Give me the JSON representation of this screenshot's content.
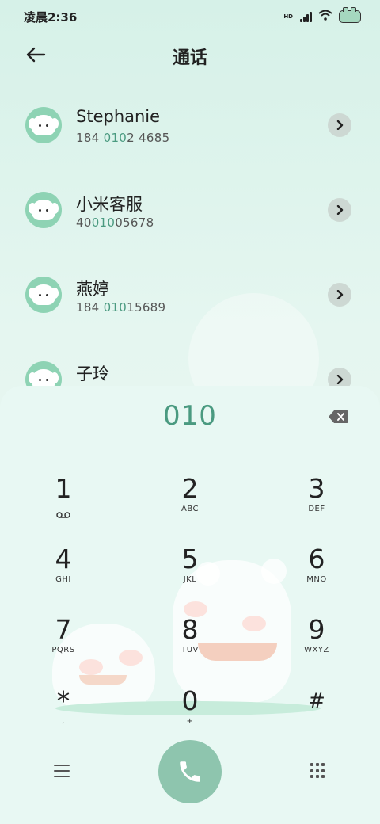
{
  "status_bar": {
    "time": "凌晨2:36",
    "hd_label": "HD",
    "icons": [
      "signal-icon",
      "wifi-icon",
      "battery-icon"
    ]
  },
  "header": {
    "title": "通话",
    "back_icon": "back-arrow-icon"
  },
  "contacts": [
    {
      "name": "Stephanie",
      "number_pre": "184 ",
      "number_hl": "010",
      "number_post": "2 4685"
    },
    {
      "name": "小米客服",
      "number_pre": "40",
      "number_hl": "010",
      "number_post": "05678"
    },
    {
      "name": "燕婷",
      "number_pre": "184 ",
      "number_hl": "010",
      "number_post": "15689"
    },
    {
      "name": "子玲",
      "number_pre": "",
      "number_hl": "",
      "number_post": ""
    }
  ],
  "dialer": {
    "input": "010",
    "keys": [
      {
        "digit": "1",
        "letters": ""
      },
      {
        "digit": "2",
        "letters": "ABC"
      },
      {
        "digit": "3",
        "letters": "DEF"
      },
      {
        "digit": "4",
        "letters": "GHI"
      },
      {
        "digit": "5",
        "letters": "JKL"
      },
      {
        "digit": "6",
        "letters": "MNO"
      },
      {
        "digit": "7",
        "letters": "PQRS"
      },
      {
        "digit": "8",
        "letters": "TUV"
      },
      {
        "digit": "9",
        "letters": "WXYZ"
      },
      {
        "digit": "*",
        "letters": ","
      },
      {
        "digit": "0",
        "letters": "+"
      },
      {
        "digit": "#",
        "letters": ""
      }
    ]
  },
  "colors": {
    "accent": "#4a9a80",
    "call_button": "#8ec5ae",
    "background": "#e5f6f0"
  }
}
